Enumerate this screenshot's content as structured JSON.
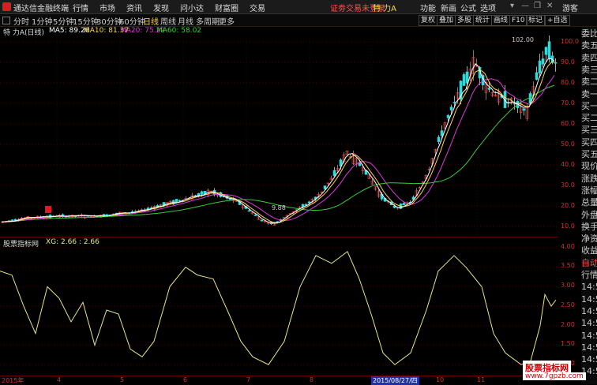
{
  "titlebar": {
    "app_name": "通达信金融终端",
    "menus": [
      "行情",
      "市场",
      "资讯",
      "发现",
      "问小达",
      "财富圈",
      "交易"
    ],
    "warning": "证劵交易未登录",
    "stock_title": "特 力A",
    "right_menus": [
      "功能",
      "新画",
      "公式",
      "选项",
      "游客"
    ]
  },
  "periods": [
    "分时",
    "1分钟",
    "5分钟",
    "15分钟",
    "30分钟",
    "60分钟",
    "日线",
    "周线",
    "月线",
    "多周期",
    "更多"
  ],
  "active_period": "日线",
  "tools": [
    "复权",
    "叠加",
    "多股",
    "统计",
    "画线",
    "F10",
    "标记",
    "+自选"
  ],
  "info_main": {
    "name": "特 力A(日线)",
    "ma5": "MA5: 89.26",
    "ma10": "MA10: 81.37",
    "ma20": "MA20: 75.29",
    "ma60": "MA60: 58.02"
  },
  "info_sub": {
    "name": "股票指标网",
    "xg": "XG: 2.66 : 2.66"
  },
  "main_axis": [
    "100.0",
    "90.0",
    "80.0",
    "70.0",
    "60.0",
    "50.0",
    "40.0",
    "30.0",
    "20.0",
    "10.0"
  ],
  "sub_axis": [
    "4.00",
    "3.50",
    "3.00",
    "2.50",
    "2.00",
    "1.50",
    "1.00"
  ],
  "annotations": {
    "high": "102.00",
    "low": "9.88"
  },
  "dates": [
    "2015年",
    "4",
    "5",
    "6",
    "7",
    "8",
    "2015/08/27/四",
    "10",
    "11"
  ],
  "side_labels": [
    "委比",
    "卖五",
    "卖四",
    "卖三",
    "卖二",
    "卖一",
    "买一",
    "买二",
    "买三",
    "买四",
    "买五",
    "现价",
    "涨跌",
    "涨幅",
    "总量",
    "外盘",
    "换手",
    "净资",
    "收益",
    "自动",
    "行情",
    "14:50",
    "14:50",
    "14:50",
    "14:50",
    "14:50",
    "14:50",
    "14:50",
    "14:50"
  ],
  "watermark": {
    "title": "股票指标网",
    "url": "www.7gpzb.com"
  },
  "colors": {
    "up": "#ff3c3c",
    "down": "#3ad6d6",
    "ma5": "#ffffff",
    "ma10": "#ffd84a",
    "ma20": "#d83cd8",
    "ma60": "#3acc3a",
    "indicator": "#e6e68a"
  }
}
